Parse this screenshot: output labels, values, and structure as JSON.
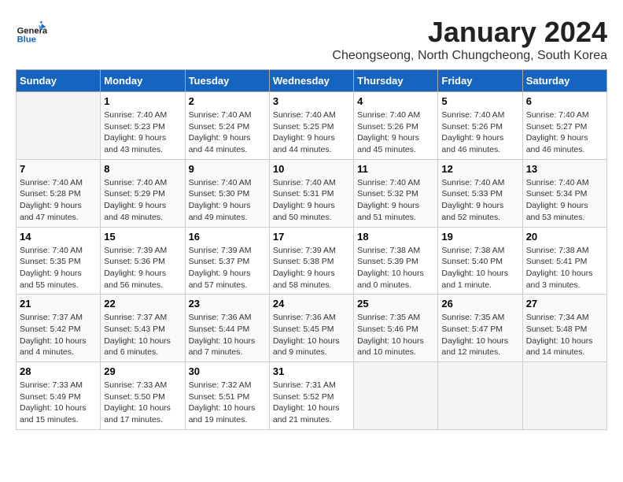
{
  "header": {
    "logo": {
      "general": "General",
      "blue": "Blue"
    },
    "title": "January 2024",
    "location": "Cheongseong, North Chungcheong, South Korea"
  },
  "days_of_week": [
    "Sunday",
    "Monday",
    "Tuesday",
    "Wednesday",
    "Thursday",
    "Friday",
    "Saturday"
  ],
  "weeks": [
    [
      {
        "day": "",
        "info": ""
      },
      {
        "day": "1",
        "info": "Sunrise: 7:40 AM\nSunset: 5:23 PM\nDaylight: 9 hours\nand 43 minutes."
      },
      {
        "day": "2",
        "info": "Sunrise: 7:40 AM\nSunset: 5:24 PM\nDaylight: 9 hours\nand 44 minutes."
      },
      {
        "day": "3",
        "info": "Sunrise: 7:40 AM\nSunset: 5:25 PM\nDaylight: 9 hours\nand 44 minutes."
      },
      {
        "day": "4",
        "info": "Sunrise: 7:40 AM\nSunset: 5:26 PM\nDaylight: 9 hours\nand 45 minutes."
      },
      {
        "day": "5",
        "info": "Sunrise: 7:40 AM\nSunset: 5:26 PM\nDaylight: 9 hours\nand 46 minutes."
      },
      {
        "day": "6",
        "info": "Sunrise: 7:40 AM\nSunset: 5:27 PM\nDaylight: 9 hours\nand 46 minutes."
      }
    ],
    [
      {
        "day": "7",
        "info": "Sunrise: 7:40 AM\nSunset: 5:28 PM\nDaylight: 9 hours\nand 47 minutes."
      },
      {
        "day": "8",
        "info": "Sunrise: 7:40 AM\nSunset: 5:29 PM\nDaylight: 9 hours\nand 48 minutes."
      },
      {
        "day": "9",
        "info": "Sunrise: 7:40 AM\nSunset: 5:30 PM\nDaylight: 9 hours\nand 49 minutes."
      },
      {
        "day": "10",
        "info": "Sunrise: 7:40 AM\nSunset: 5:31 PM\nDaylight: 9 hours\nand 50 minutes."
      },
      {
        "day": "11",
        "info": "Sunrise: 7:40 AM\nSunset: 5:32 PM\nDaylight: 9 hours\nand 51 minutes."
      },
      {
        "day": "12",
        "info": "Sunrise: 7:40 AM\nSunset: 5:33 PM\nDaylight: 9 hours\nand 52 minutes."
      },
      {
        "day": "13",
        "info": "Sunrise: 7:40 AM\nSunset: 5:34 PM\nDaylight: 9 hours\nand 53 minutes."
      }
    ],
    [
      {
        "day": "14",
        "info": "Sunrise: 7:40 AM\nSunset: 5:35 PM\nDaylight: 9 hours\nand 55 minutes."
      },
      {
        "day": "15",
        "info": "Sunrise: 7:39 AM\nSunset: 5:36 PM\nDaylight: 9 hours\nand 56 minutes."
      },
      {
        "day": "16",
        "info": "Sunrise: 7:39 AM\nSunset: 5:37 PM\nDaylight: 9 hours\nand 57 minutes."
      },
      {
        "day": "17",
        "info": "Sunrise: 7:39 AM\nSunset: 5:38 PM\nDaylight: 9 hours\nand 58 minutes."
      },
      {
        "day": "18",
        "info": "Sunrise: 7:38 AM\nSunset: 5:39 PM\nDaylight: 10 hours\nand 0 minutes."
      },
      {
        "day": "19",
        "info": "Sunrise: 7:38 AM\nSunset: 5:40 PM\nDaylight: 10 hours\nand 1 minute."
      },
      {
        "day": "20",
        "info": "Sunrise: 7:38 AM\nSunset: 5:41 PM\nDaylight: 10 hours\nand 3 minutes."
      }
    ],
    [
      {
        "day": "21",
        "info": "Sunrise: 7:37 AM\nSunset: 5:42 PM\nDaylight: 10 hours\nand 4 minutes."
      },
      {
        "day": "22",
        "info": "Sunrise: 7:37 AM\nSunset: 5:43 PM\nDaylight: 10 hours\nand 6 minutes."
      },
      {
        "day": "23",
        "info": "Sunrise: 7:36 AM\nSunset: 5:44 PM\nDaylight: 10 hours\nand 7 minutes."
      },
      {
        "day": "24",
        "info": "Sunrise: 7:36 AM\nSunset: 5:45 PM\nDaylight: 10 hours\nand 9 minutes."
      },
      {
        "day": "25",
        "info": "Sunrise: 7:35 AM\nSunset: 5:46 PM\nDaylight: 10 hours\nand 10 minutes."
      },
      {
        "day": "26",
        "info": "Sunrise: 7:35 AM\nSunset: 5:47 PM\nDaylight: 10 hours\nand 12 minutes."
      },
      {
        "day": "27",
        "info": "Sunrise: 7:34 AM\nSunset: 5:48 PM\nDaylight: 10 hours\nand 14 minutes."
      }
    ],
    [
      {
        "day": "28",
        "info": "Sunrise: 7:33 AM\nSunset: 5:49 PM\nDaylight: 10 hours\nand 15 minutes."
      },
      {
        "day": "29",
        "info": "Sunrise: 7:33 AM\nSunset: 5:50 PM\nDaylight: 10 hours\nand 17 minutes."
      },
      {
        "day": "30",
        "info": "Sunrise: 7:32 AM\nSunset: 5:51 PM\nDaylight: 10 hours\nand 19 minutes."
      },
      {
        "day": "31",
        "info": "Sunrise: 7:31 AM\nSunset: 5:52 PM\nDaylight: 10 hours\nand 21 minutes."
      },
      {
        "day": "",
        "info": ""
      },
      {
        "day": "",
        "info": ""
      },
      {
        "day": "",
        "info": ""
      }
    ]
  ]
}
